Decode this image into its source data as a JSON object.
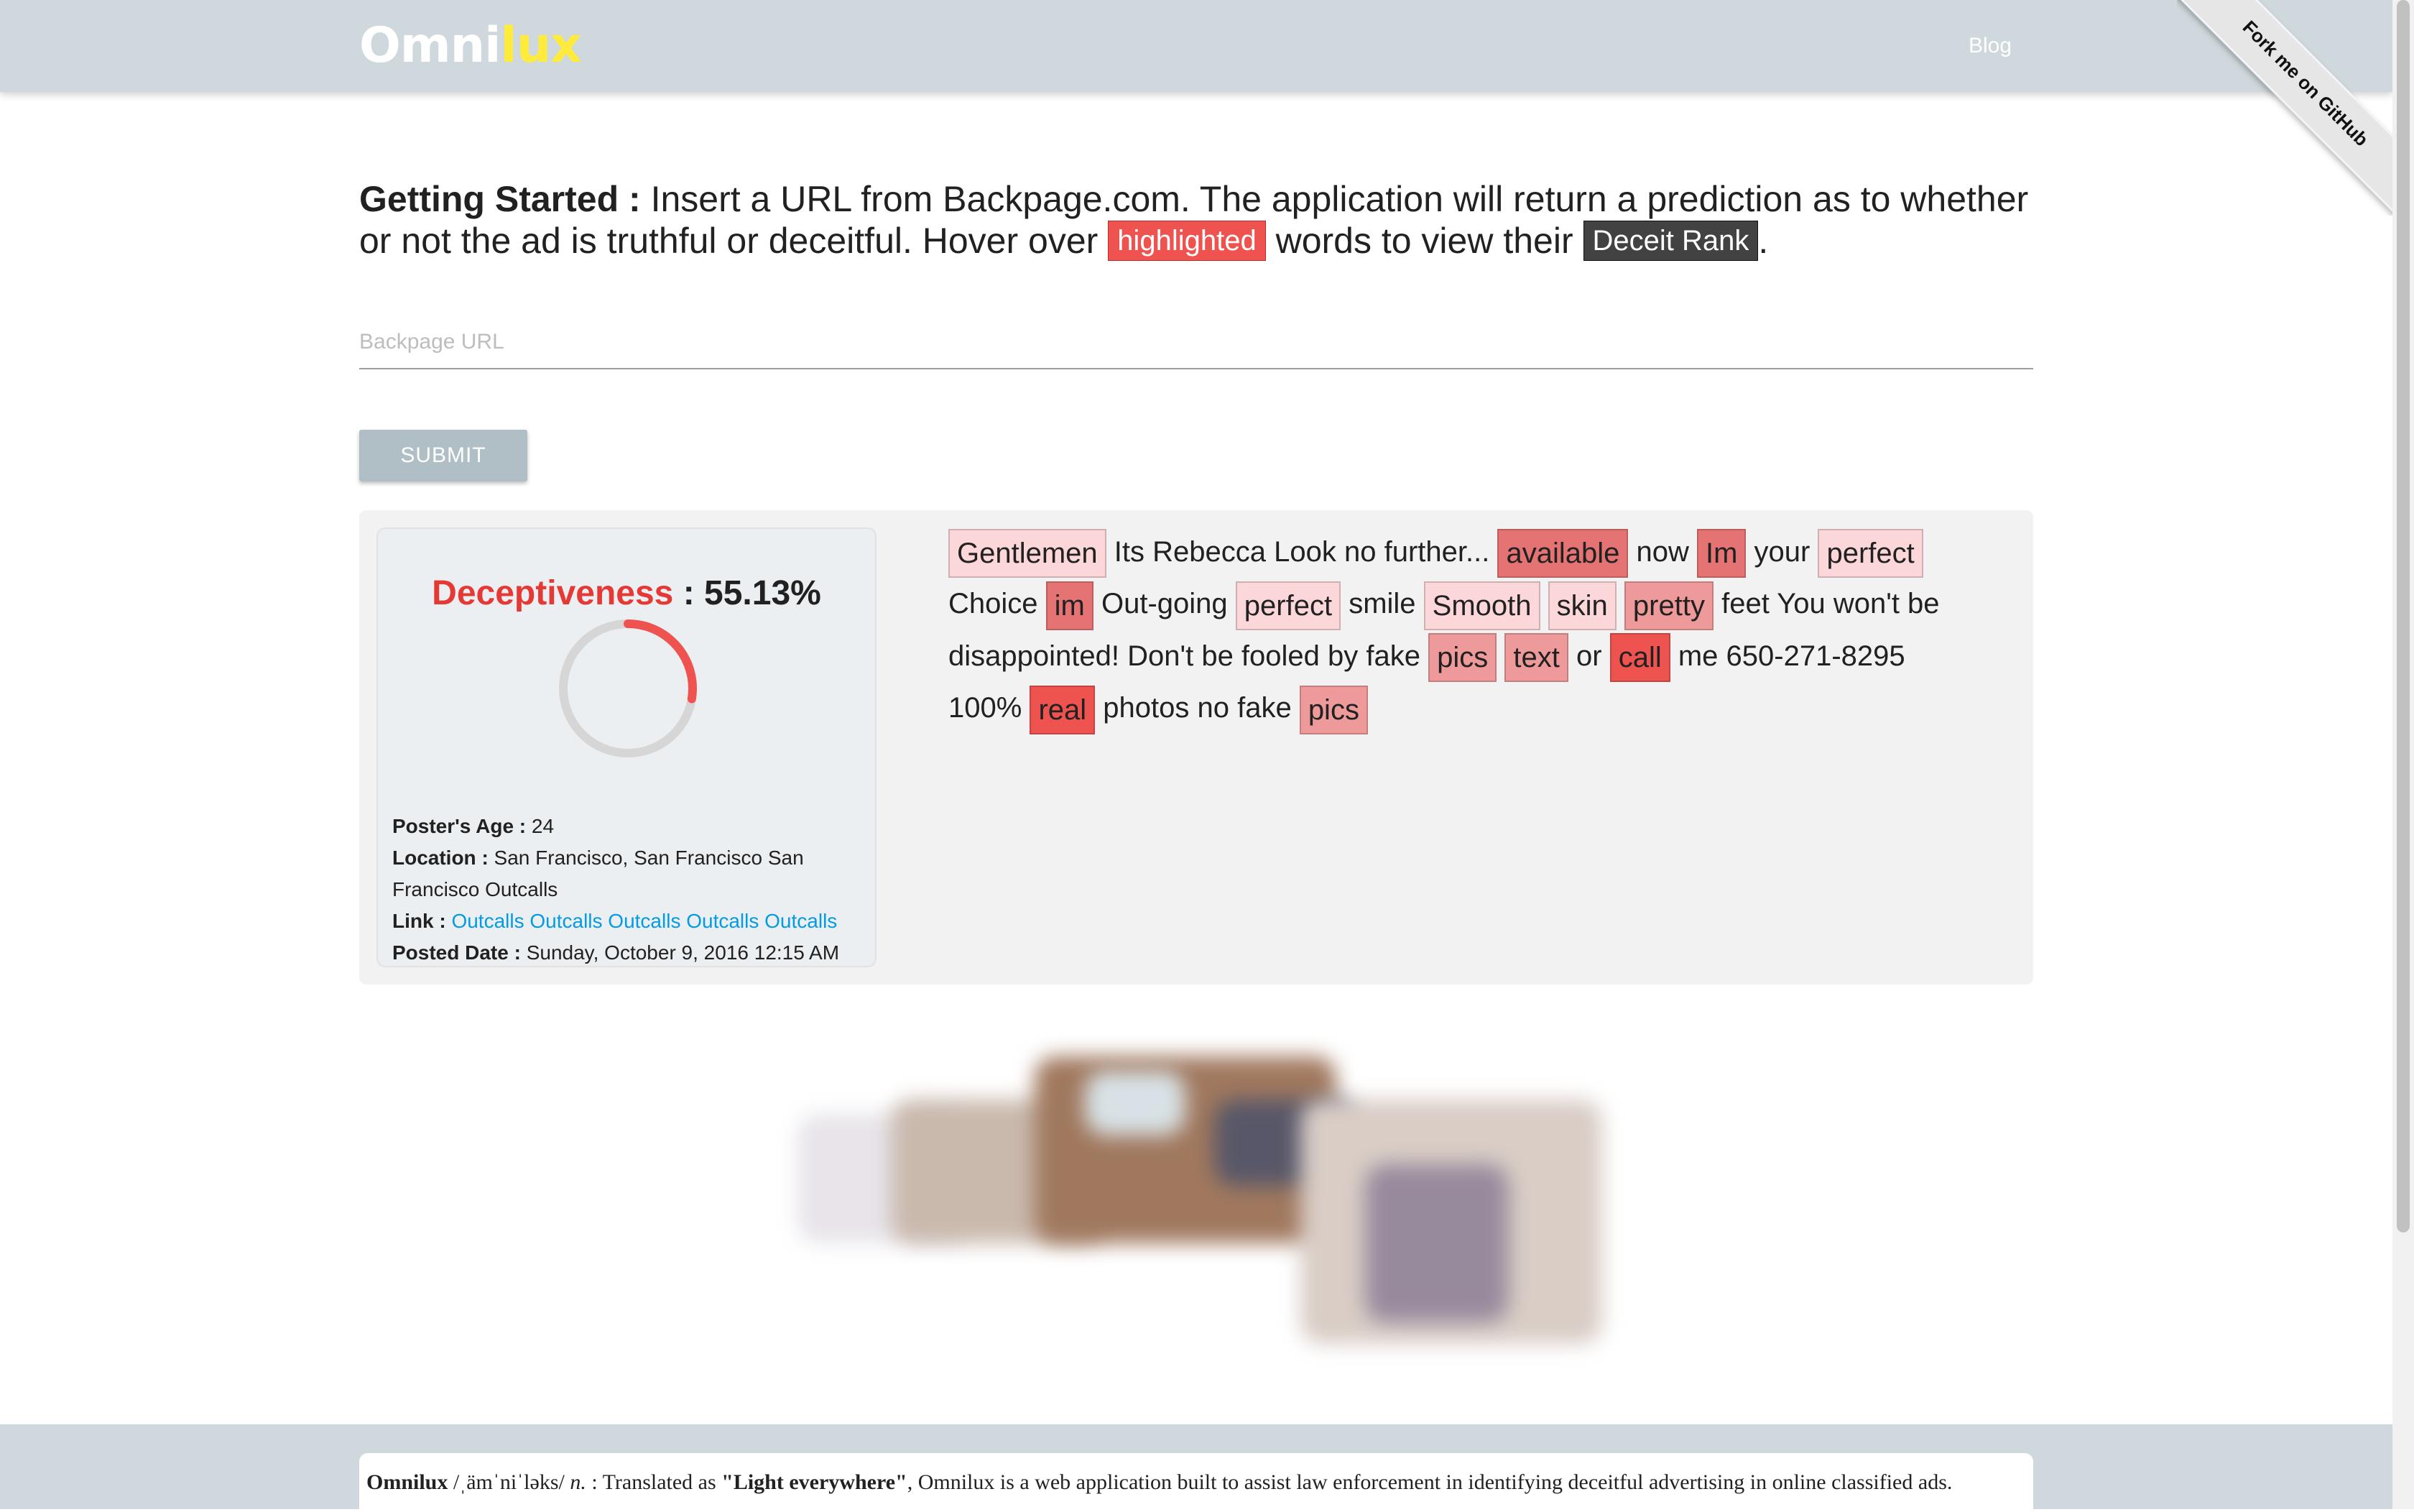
{
  "brand": {
    "part1": "Omni",
    "part2": "lux"
  },
  "nav": {
    "blog": "Blog",
    "ribbon": "Fork me on GitHub"
  },
  "intro": {
    "heading": "Getting Started :",
    "text1": " Insert a URL from Backpage.com. The application will return a prediction as to whether or not the ad is truthful or deceitful. Hover over ",
    "highlighted": "highlighted",
    "text2": " words to view their ",
    "deceit_rank": "Deceit Rank",
    "text3": "."
  },
  "form": {
    "url_placeholder": "Backpage URL",
    "submit": "SUBMIT"
  },
  "result": {
    "label": "Deceptiveness",
    "separator": " : ",
    "value": "55.13%",
    "score_fraction": 0.5513,
    "age_label": "Poster's Age :",
    "age": "24",
    "location_label": "Location :",
    "location": "San Francisco, San Francisco San Francisco Outcalls",
    "link_label": "Link :",
    "link": "Outcalls Outcalls Outcalls Outcalls Outcalls",
    "date_label": "Posted Date :",
    "date": "Sunday, October 9, 2016 12:15 AM"
  },
  "ad_words": [
    {
      "t": "Gentlemen",
      "c": "#fcd7da"
    },
    {
      "t": "Its Rebecca Look no further..."
    },
    {
      "t": "available",
      "c": "#e57373"
    },
    {
      "t": "now"
    },
    {
      "t": "Im",
      "c": "#e57373"
    },
    {
      "t": "your"
    },
    {
      "t": "perfect",
      "c": "#fcd7da"
    },
    {
      "t": "Choice"
    },
    {
      "t": "im",
      "c": "#e57373"
    },
    {
      "t": "Out-going"
    },
    {
      "t": "perfect",
      "c": "#fcd7da"
    },
    {
      "t": "smile"
    },
    {
      "t": "Smooth",
      "c": "#fcd7da"
    },
    {
      "t": "skin",
      "c": "#fcd7da"
    },
    {
      "t": "pretty",
      "c": "#ef9a9a"
    },
    {
      "t": "feet You won't be disappointed! Don't be fooled by fake"
    },
    {
      "t": "pics",
      "c": "#ef9a9a"
    },
    {
      "t": "text",
      "c": "#ef9a9a"
    },
    {
      "t": "or"
    },
    {
      "t": "call",
      "c": "#ef5350"
    },
    {
      "t": "me 650-271-8295 100%"
    },
    {
      "t": "real",
      "c": "#ef5350"
    },
    {
      "t": "photos no fake"
    },
    {
      "t": "pics",
      "c": "#ef9a9a"
    }
  ],
  "footer": {
    "word": "Omnilux",
    "pron": " /ˌämˈniˈləks/ ",
    "pos": "n.",
    "mid": " : Translated as ",
    "trans": "\"Light everywhere\"",
    "rest": ", Omnilux is a web application built to assist law enforcement in identifying deceitful advertising in online classified ads."
  },
  "colors": {
    "nav": "#cfd8dc",
    "accent_red": "#e53935",
    "logo_yellow": "#ffeb3b",
    "link": "#039be5"
  }
}
